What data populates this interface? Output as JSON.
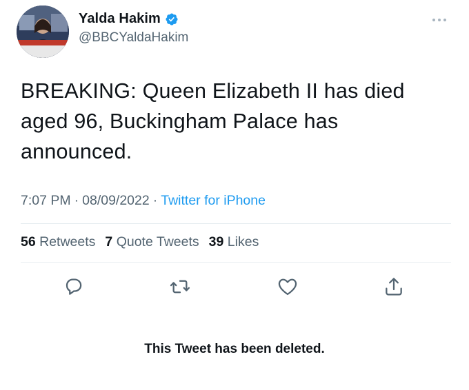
{
  "author": {
    "display_name": "Yalda Hakim",
    "handle": "@BBCYaldaHakim",
    "verified_icon": "verified-badge-icon",
    "avatar_icon": "avatar"
  },
  "tweet": {
    "text": "BREAKING: Queen Elizabeth II has died aged 96, Buckingham Palace has announced.",
    "time": "7:07 PM",
    "date": "08/09/2022",
    "separator": "·",
    "source": "Twitter for iPhone"
  },
  "stats": {
    "retweets_count": "56",
    "retweets_label": "Retweets",
    "quote_count": "7",
    "quote_label": "Quote Tweets",
    "likes_count": "39",
    "likes_label": "Likes"
  },
  "actions": {
    "reply_icon": "reply-icon",
    "retweet_icon": "retweet-icon",
    "like_icon": "heart-icon",
    "share_icon": "share-icon",
    "more_icon": "more-icon"
  },
  "notice": {
    "text": "This Tweet has been deleted."
  },
  "colors": {
    "text": "#0f1419",
    "secondary": "#536471",
    "link": "#1d9bf0",
    "divider": "#e6ecf0"
  }
}
